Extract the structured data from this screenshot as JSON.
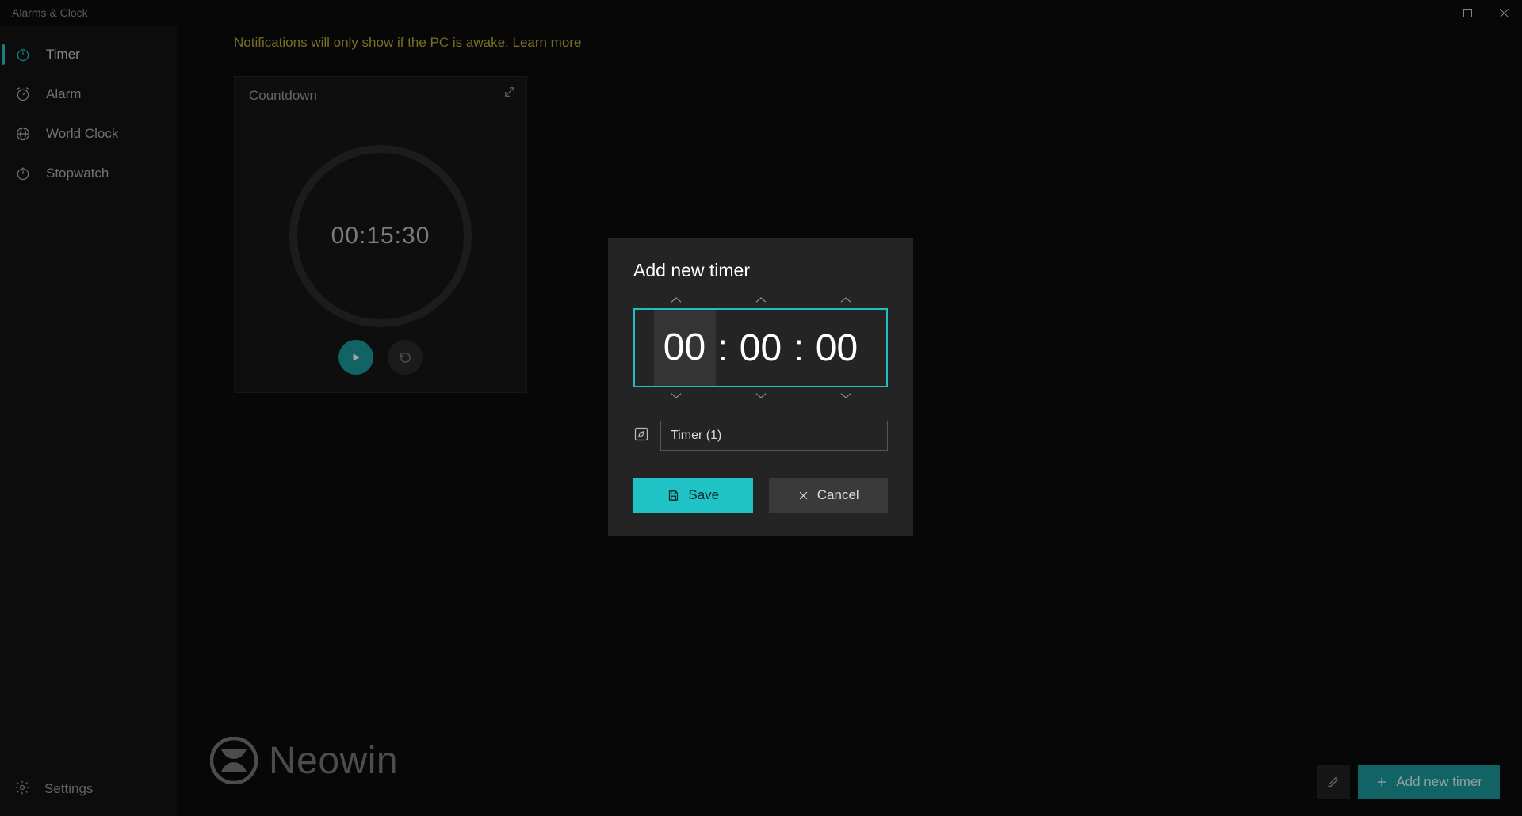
{
  "app": {
    "title": "Alarms & Clock"
  },
  "sidebar": {
    "items": [
      {
        "label": "Timer"
      },
      {
        "label": "Alarm"
      },
      {
        "label": "World Clock"
      },
      {
        "label": "Stopwatch"
      }
    ],
    "settings_label": "Settings"
  },
  "notice": {
    "text": "Notifications will only show if the PC is awake. ",
    "link": "Learn more"
  },
  "timer_card": {
    "title": "Countdown",
    "time": "00:15:30"
  },
  "footer": {
    "add_label": "Add new timer"
  },
  "dialog": {
    "title": "Add new timer",
    "hours": "00",
    "minutes": "00",
    "seconds": "00",
    "colon": ":",
    "name_value": "Timer (1)",
    "save_label": "Save",
    "cancel_label": "Cancel"
  },
  "watermark": {
    "text": "Neowin"
  }
}
